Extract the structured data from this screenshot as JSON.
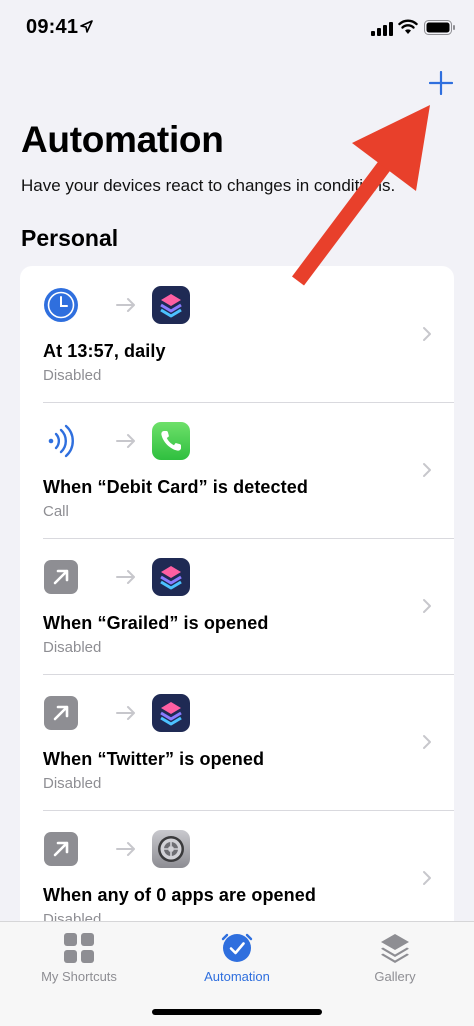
{
  "status_bar": {
    "time": "09:41"
  },
  "header": {
    "add_label": "+",
    "title": "Automation",
    "subtitle": "Have your devices react to changes in conditions."
  },
  "section": {
    "title": "Personal"
  },
  "automations": [
    {
      "title": "At 13:57, daily",
      "subtitle": "Disabled",
      "trigger_icon": "clock-icon",
      "action_icon": "shortcuts-app-icon"
    },
    {
      "title": "When “Debit Card” is detected",
      "subtitle": "Call",
      "trigger_icon": "nfc-icon",
      "action_icon": "phone-app-icon"
    },
    {
      "title": "When “Grailed” is opened",
      "subtitle": "Disabled",
      "trigger_icon": "app-open-icon",
      "action_icon": "shortcuts-app-icon"
    },
    {
      "title": "When “Twitter” is opened",
      "subtitle": "Disabled",
      "trigger_icon": "app-open-icon",
      "action_icon": "shortcuts-app-icon"
    },
    {
      "title": "When any of 0 apps are opened",
      "subtitle": "Disabled",
      "trigger_icon": "app-open-icon",
      "action_icon": "settings-app-icon"
    }
  ],
  "tabs": [
    {
      "label": "My Shortcuts",
      "icon": "grid-icon",
      "active": false
    },
    {
      "label": "Automation",
      "icon": "check-clock-icon",
      "active": true
    },
    {
      "label": "Gallery",
      "icon": "layers-icon",
      "active": false
    }
  ],
  "colors": {
    "accent": "#2f6fde",
    "annotation": "#e8402b",
    "background": "#f2f2f7"
  }
}
